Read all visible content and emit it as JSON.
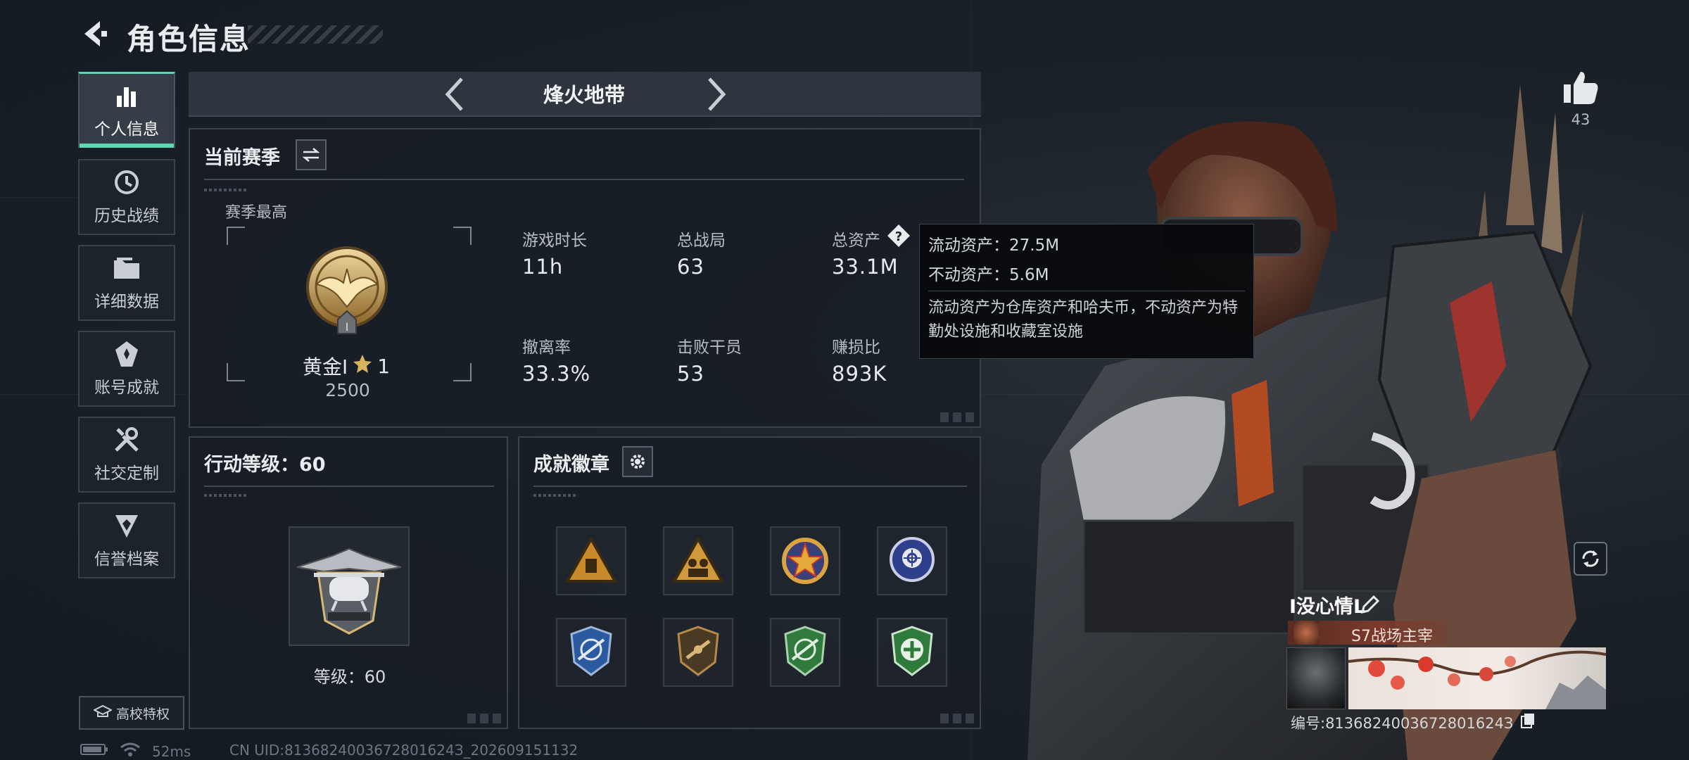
{
  "header": {
    "title": "角色信息"
  },
  "sidebar": {
    "items": [
      {
        "label": "个人信息",
        "icon": "bar-chart-icon",
        "active": true
      },
      {
        "label": "历史战绩",
        "icon": "clock-icon",
        "active": false
      },
      {
        "label": "详细数据",
        "icon": "folder-icon",
        "active": false
      },
      {
        "label": "账号成就",
        "icon": "achievement-icon",
        "active": false
      },
      {
        "label": "社交定制",
        "icon": "tools-icon",
        "active": false
      },
      {
        "label": "信誉档案",
        "icon": "shield-icon",
        "active": false
      }
    ],
    "school_button": "高校特权"
  },
  "status": {
    "ping": "52ms",
    "uid_line": "CN UID:8136824003672801624З_202609151132"
  },
  "mode": {
    "title": "烽火地带"
  },
  "season": {
    "title": "当前赛季",
    "best_label": "赛季最高",
    "rank_name": "黄金I",
    "rank_stars": "1",
    "rank_score": "2500",
    "stats": [
      {
        "label": "游戏时长",
        "value": "11h"
      },
      {
        "label": "总战局",
        "value": "63"
      },
      {
        "label": "总资产",
        "value": "33.1M"
      },
      {
        "label": "撤离率",
        "value": "33.3%"
      },
      {
        "label": "击败干员",
        "value": "53"
      },
      {
        "label": "赚损比",
        "value": "893K"
      }
    ]
  },
  "tooltip": {
    "liquid": "流动资产：27.5M",
    "fixed": "不动资产：5.6M",
    "description": "流动资产为仓库资产和哈夫币，不动资产为特勤处设施和收藏室设施"
  },
  "action_level": {
    "title": "行动等级：60",
    "level_text": "等级：60"
  },
  "achievements": {
    "title": "成就徽章",
    "badges": [
      {
        "name": "triangle-bag-badge",
        "color": "#c98a2a"
      },
      {
        "name": "triangle-squad-badge",
        "color": "#c98a2a"
      },
      {
        "name": "star-emblem-badge",
        "color": "#c0392b"
      },
      {
        "name": "target-emblem-badge",
        "color": "#3b4fa8"
      },
      {
        "name": "blue-shield-badge",
        "color": "#2c5aa0"
      },
      {
        "name": "bronze-shield-badge",
        "color": "#8a6a3a"
      },
      {
        "name": "green-shield-badge",
        "color": "#2f7a3c"
      },
      {
        "name": "green-cross-badge",
        "color": "#2f7a3c"
      }
    ]
  },
  "profile": {
    "likes": "43",
    "player_name": "I没心情L",
    "title_tag": "S7战场主宰",
    "player_uid": "编号:8136824003672801624З"
  }
}
